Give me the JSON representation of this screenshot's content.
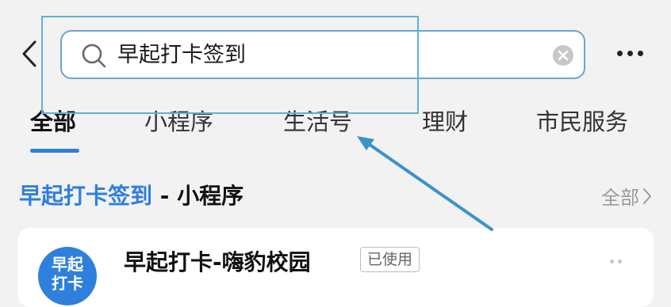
{
  "search": {
    "query": "早起打卡签到"
  },
  "tabs": [
    {
      "label": "全部",
      "active": true
    },
    {
      "label": "小程序",
      "active": false
    },
    {
      "label": "生活号",
      "active": false
    },
    {
      "label": "理财",
      "active": false
    },
    {
      "label": "市民服务",
      "active": false
    }
  ],
  "section": {
    "title_highlight": "早起打卡签到",
    "title_suffix": " - 小程序",
    "all_label": "全部"
  },
  "result": {
    "icon_text_line1": "早起",
    "icon_text_line2": "打卡",
    "name": "早起打卡-嗨豹校园",
    "badge": "已使用"
  },
  "colors": {
    "accent": "#2f7fdc",
    "annotation": "#5fb1d2"
  }
}
